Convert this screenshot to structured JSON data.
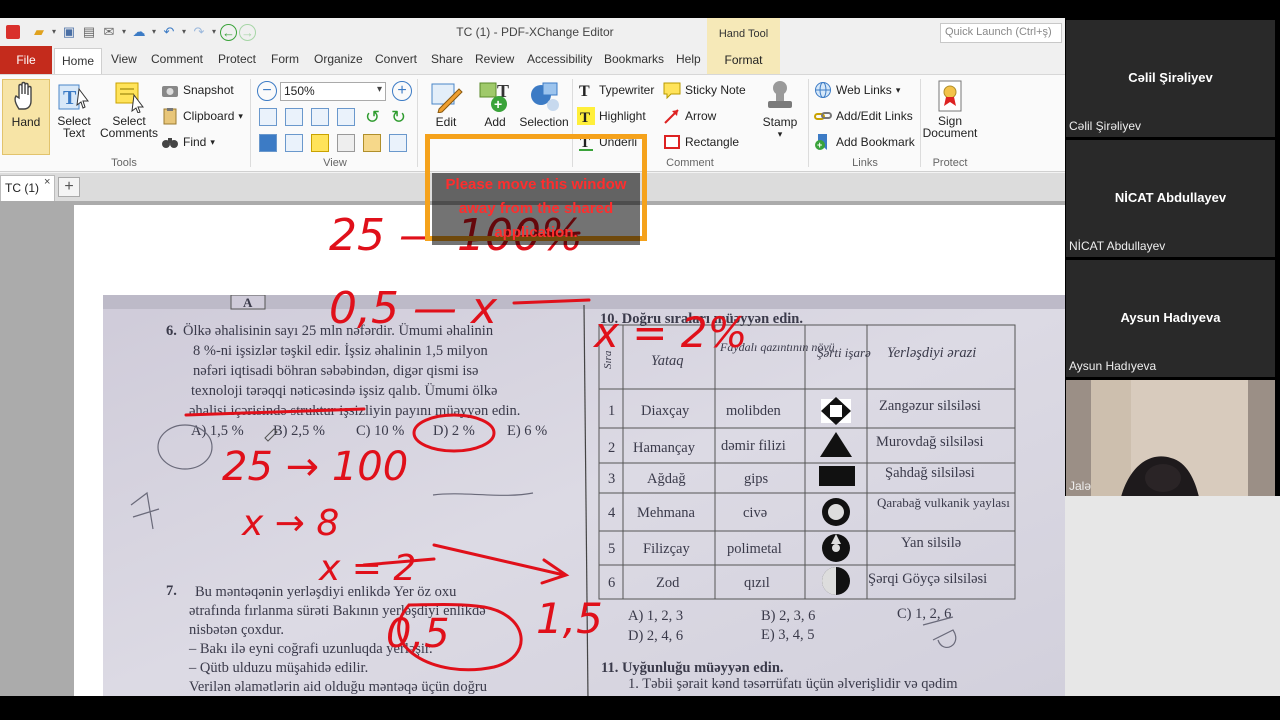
{
  "window": {
    "title": "TC (1) - PDF-XChange Editor",
    "quick_launch_placeholder": "Quick Launch (Ctrl+ş)",
    "context_tab_group": "Hand Tool"
  },
  "tabs": [
    "File",
    "Home",
    "View",
    "Comment",
    "Protect",
    "Form",
    "Organize",
    "Convert",
    "Share",
    "Review",
    "Accessibility",
    "Bookmarks",
    "Help",
    "Format"
  ],
  "ribbon": {
    "tools": {
      "hand": "Hand",
      "select_text_1": "Select",
      "select_text_2": "Text",
      "select_comments_1": "Select",
      "select_comments_2": "Comments",
      "snapshot": "Snapshot",
      "clipboard": "Clipboard",
      "find": "Find",
      "label": "Tools"
    },
    "view": {
      "zoom": "150%",
      "label": "View"
    },
    "edit": {
      "edit": "Edit",
      "add": "Add",
      "selection": "Selection"
    },
    "comment": {
      "typewriter": "Typewriter",
      "sticky_note": "Sticky Note",
      "highlight": "Highlight",
      "arrow": "Arrow",
      "underline": "Underli",
      "rectangle": "Rectangle",
      "stamp": "Stamp",
      "label": "Comment"
    },
    "links": {
      "web_links": "Web Links",
      "add_edit_links": "Add/Edit Links",
      "add_bookmark": "Add Bookmark",
      "label": "Links"
    },
    "protect": {
      "sign_1": "Sign",
      "sign_2": "Document",
      "label": "Protect"
    }
  },
  "document_tab": {
    "name": "TC (1)",
    "close": "×",
    "new": "+"
  },
  "share_notice": "Please move this window away from the shared application.",
  "participants": [
    {
      "display": "Cəlil Şirəliyev",
      "caption": "Cəlil Şirəliyev"
    },
    {
      "display": "NİCAT Abdullayev",
      "caption": "NİCAT Abdullayev"
    },
    {
      "display": "Aysun Hadıyeva",
      "caption": "Aysun Hadıyeva"
    }
  ],
  "video_caption": "Jalə",
  "worksheet": {
    "q6_head": "6.",
    "q6_lines": [
      "Ölkə əhalisinin sayı 25 mln nəfərdir. Ümumi əhalinin",
      "8 %-ni işsizlər təşkil edir. İşsiz əhalinin 1,5 milyon",
      "nəfəri iqtisadi böhran səbəbindən, digər qismi isə",
      "texnoloji tərəqqi nəticəsində işsiz qalıb. Ümumi ölkə",
      "əhalisi içərisində struktur işsizliyin payını müəyyən edin."
    ],
    "q6_options": [
      "A) 1,5 %",
      "B) 2,5 %",
      "C) 10 %",
      "D) 2 %",
      "E) 6 %"
    ],
    "q7_head": "7.",
    "q7_lines": [
      "Bu məntəqənin yerləşdiyi enlikdə Yer öz oxu",
      "ətrafında fırlanma sürəti Bakının yerləşdiyi enlikdə",
      "nisbətən çoxdur.",
      "– Bakı ilə eyni coğrafi uzunluqda yerləşir.",
      "– Qütb ulduzu müşahidə edilir.",
      "Verilən əlamətlərin aid olduğu məntəqə üçün doğru"
    ],
    "q10_title": "10. Doğru sıraları müəyyən edin.",
    "table_headers": [
      "Sıra",
      "Yataq",
      "Faydalı qazıntının növü",
      "Şərti işarə",
      "Yerləşdiyi ərazi"
    ],
    "table_rows": [
      [
        "1",
        "Diaxçay",
        "molibden",
        "Zangəzur silsiləsi"
      ],
      [
        "2",
        "Hamançay",
        "dəmir filizi",
        "Murovdağ silsiləsi"
      ],
      [
        "3",
        "Ağdağ",
        "gips",
        "Şahdağ silsiləsi"
      ],
      [
        "4",
        "Mehmana",
        "civə",
        "Qarabağ vulkanik yaylası"
      ],
      [
        "5",
        "Filizçay",
        "polimetal",
        "Yan silsilə"
      ],
      [
        "6",
        "Zod",
        "qızıl",
        "Şərqi Göyçə silsiləsi"
      ]
    ],
    "q10_options_1": [
      "A) 1, 2, 3",
      "B) 2, 3, 6",
      "C) 1, 2, 6"
    ],
    "q10_options_2": [
      "D) 2, 4, 6",
      "E) 3, 4, 5"
    ],
    "q11_title": "11. Uyğunluğu müəyyən edin.",
    "q11_line": "1. Təbii şərait kənd təsərrüfatı üçün əlverişlidir və qədim",
    "header_letter": "A"
  },
  "handwriting": {
    "top_line_1": "25 — 100%",
    "top_line_2": "0,5 — x",
    "top_line_3": "x = 2%",
    "calc_1": "25 → 100",
    "calc_2": "x → 8",
    "calc_3": "x = 2",
    "calc_4": "1,5",
    "calc_5": "0,5"
  },
  "colors": {
    "ink_red": "#e0101a",
    "accent_file": "#c42b1c",
    "notice_border": "#f5a21b"
  }
}
